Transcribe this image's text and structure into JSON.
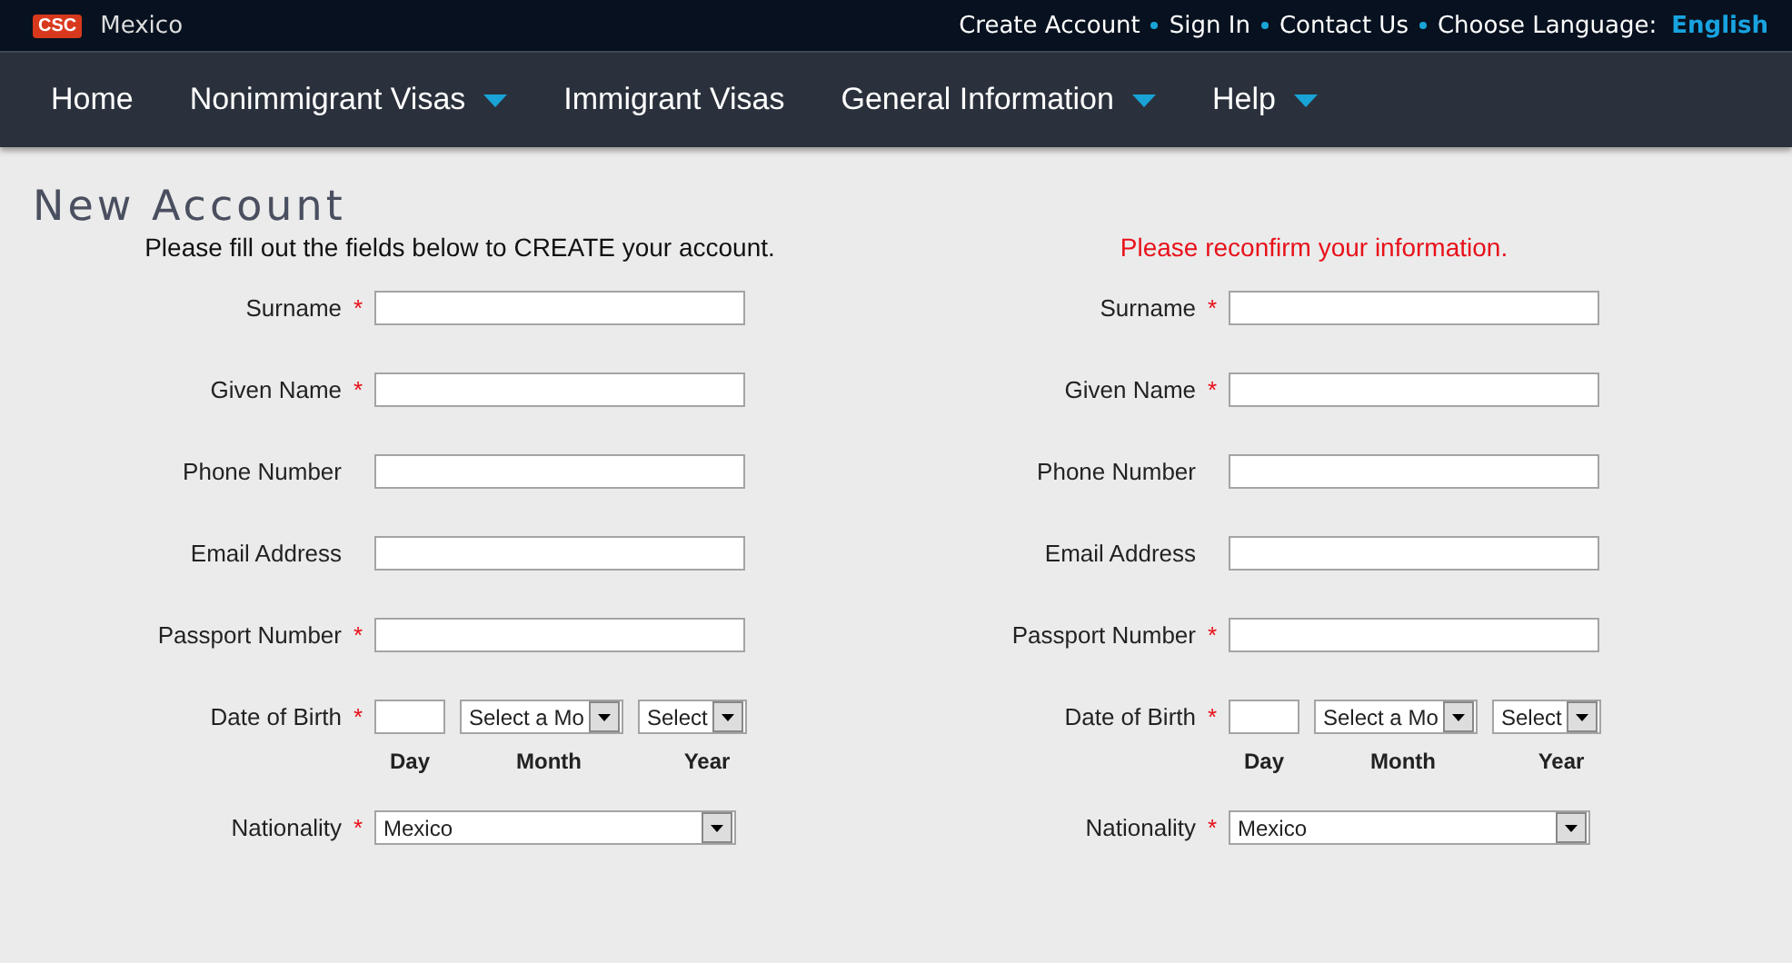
{
  "header": {
    "logo": "CSC",
    "country": "Mexico",
    "links": [
      "Create Account",
      "Sign In",
      "Contact Us"
    ],
    "language_label": "Choose Language:",
    "language": "English"
  },
  "nav": [
    {
      "label": "Home",
      "dropdown": false
    },
    {
      "label": "Nonimmigrant Visas",
      "dropdown": true
    },
    {
      "label": "Immigrant Visas",
      "dropdown": false
    },
    {
      "label": "General Information",
      "dropdown": true
    },
    {
      "label": "Help",
      "dropdown": true
    }
  ],
  "page_title": "New Account",
  "required_mark": "*",
  "columns": [
    {
      "kind": "entry",
      "intro": "Please fill out the fields below to CREATE your account.",
      "fields": [
        {
          "kind": "text",
          "label": "Surname",
          "required": true
        },
        {
          "kind": "text",
          "label": "Given Name",
          "required": true
        },
        {
          "kind": "text",
          "label": "Phone Number",
          "required": false
        },
        {
          "kind": "text",
          "label": "Email Address",
          "required": false
        },
        {
          "kind": "text",
          "label": "Passport Number",
          "required": true
        },
        {
          "kind": "date",
          "label": "Date of Birth",
          "required": true,
          "month_value": "Select a Mo",
          "year_value": "Select",
          "captions": [
            "Day",
            "Month",
            "Year"
          ]
        },
        {
          "kind": "select",
          "label": "Nationality",
          "required": true,
          "value": "Mexico"
        }
      ]
    },
    {
      "kind": "confirm",
      "intro": "Please reconfirm your information.",
      "fields": [
        {
          "kind": "text",
          "label": "Surname",
          "required": true
        },
        {
          "kind": "text",
          "label": "Given Name",
          "required": true
        },
        {
          "kind": "text",
          "label": "Phone Number",
          "required": false
        },
        {
          "kind": "text",
          "label": "Email Address",
          "required": false
        },
        {
          "kind": "text",
          "label": "Passport Number",
          "required": true
        },
        {
          "kind": "date",
          "label": "Date of Birth",
          "required": true,
          "month_value": "Select a Mo",
          "year_value": "Select",
          "captions": [
            "Day",
            "Month",
            "Year"
          ]
        },
        {
          "kind": "select",
          "label": "Nationality",
          "required": true,
          "value": "Mexico"
        }
      ]
    }
  ]
}
